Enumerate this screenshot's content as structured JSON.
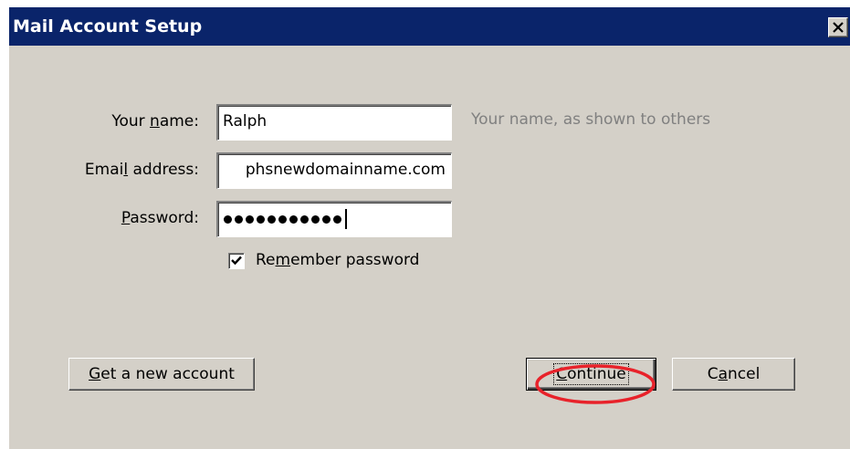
{
  "window": {
    "title": "Mail Account Setup",
    "close_glyph": "×",
    "titlebar_color": "#0a246a"
  },
  "form": {
    "name_label": {
      "before": "Your ",
      "mnemonic": "n",
      "after": "ame:"
    },
    "name_value": "Ralph",
    "name_hint": "Your name, as shown to others",
    "email_label": {
      "before": "Emai",
      "mnemonic": "l",
      "after": " address:"
    },
    "email_value": "phsnewdomainname.com",
    "password_label": {
      "before": "",
      "mnemonic": "P",
      "after": "assword:"
    },
    "password_mask_count": 11,
    "remember_checked": true,
    "remember_label": {
      "before": "Re",
      "mnemonic": "m",
      "after": "ember password"
    }
  },
  "buttons": {
    "get_account": {
      "before": "",
      "mnemonic": "G",
      "after": "et a new account"
    },
    "continue": {
      "before": "",
      "mnemonic": "C",
      "after": "ontinue"
    },
    "cancel": {
      "before": "C",
      "mnemonic": "a",
      "after": "ncel"
    }
  },
  "annotation": {
    "highlight_color": "#e8222a"
  }
}
